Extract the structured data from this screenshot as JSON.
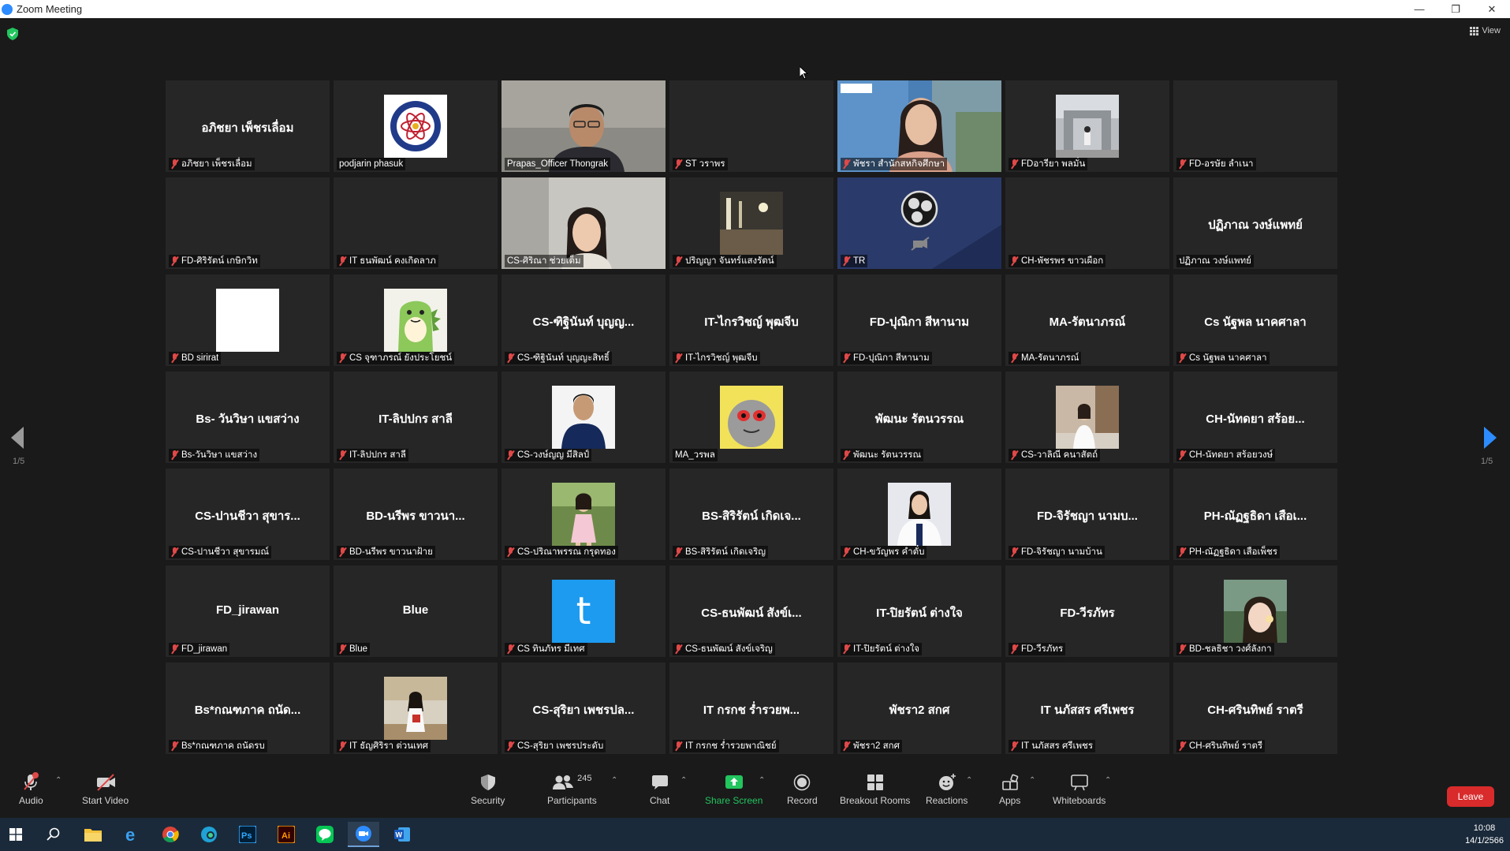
{
  "window": {
    "title": "Zoom Meeting"
  },
  "view_label": "View",
  "page_indicator": "1/5",
  "tiles": [
    {
      "center": "อภิชยา เพ็ชรเลื่อม",
      "label": "อภิชยา เพ็ชรเลื่อม",
      "muted": true,
      "kind": "name"
    },
    {
      "center": "",
      "label": "podjarin phasuk",
      "muted": false,
      "kind": "logo"
    },
    {
      "center": "",
      "label": "Prapas_Officer Thongrak",
      "muted": false,
      "kind": "video-man",
      "speaking": true
    },
    {
      "center": "",
      "label": "ST วราพร",
      "muted": true,
      "kind": "blank"
    },
    {
      "center": "",
      "label": "พัชรา สำนักสหกิจศึกษา",
      "muted": true,
      "kind": "video-woman"
    },
    {
      "center": "",
      "label": "FDอารียา พลมั่น",
      "muted": true,
      "kind": "photo-building"
    },
    {
      "center": "",
      "label": "FD-อรษัย ลำเนา",
      "muted": true,
      "kind": "blank"
    },
    {
      "center": "",
      "label": "FD-ศิริรัตน์ เกษิกวิท",
      "muted": true,
      "kind": "blank"
    },
    {
      "center": "",
      "label": "IT ธนพัฒน์ คงเกิดลาภ",
      "muted": true,
      "kind": "blank"
    },
    {
      "center": "",
      "label": "CS-ศิริณา ช่วยเต็ม",
      "muted": false,
      "kind": "video-girl"
    },
    {
      "center": "",
      "label": "ปริญญา จันทร์แสงรัตน์",
      "muted": true,
      "kind": "photo-dark"
    },
    {
      "center": "",
      "label": "TR",
      "muted": true,
      "kind": "obs"
    },
    {
      "center": "",
      "label": "CH-พัชรพร ขาวเผือก",
      "muted": true,
      "kind": "blank"
    },
    {
      "center": "ปฏิภาณ วงษ์แพทย์",
      "label": "ปฏิภาณ วงษ์แพทย์",
      "muted": false,
      "kind": "name"
    },
    {
      "center": "",
      "label": "BD sirirat",
      "muted": true,
      "kind": "white"
    },
    {
      "center": "",
      "label": "CS จุฑาภรณ์ ยังประโยชน์",
      "muted": true,
      "kind": "dino"
    },
    {
      "center": "CS-ฑิฐินันท์ บุญญ...",
      "label": "CS-ฑิฐินันท์ บุญญะสิทธิ์",
      "muted": true,
      "kind": "name"
    },
    {
      "center": "IT-ไกรวิชญ์ พุฒจีบ",
      "label": "IT-ไกรวิชญ์ พุฒจีบ",
      "muted": true,
      "kind": "name"
    },
    {
      "center": "FD-ปุณิกา สีหานาม",
      "label": "FD-ปุณิกา สีหานาม",
      "muted": true,
      "kind": "name"
    },
    {
      "center": "MA-รัตนาภรณ์",
      "label": "MA-รัตนาภรณ์",
      "muted": true,
      "kind": "name"
    },
    {
      "center": "Cs นัฐพล นาคศาลา",
      "label": "Cs นัฐพล นาคศาลา",
      "muted": true,
      "kind": "name"
    },
    {
      "center": "Bs- วันวิษา แขสว่าง",
      "label": "Bs-วันวิษา แขสว่าง",
      "muted": true,
      "kind": "name"
    },
    {
      "center": "IT-ลิปปกร สาลี",
      "label": "IT-ลิปปกร สาลี",
      "muted": true,
      "kind": "name"
    },
    {
      "center": "",
      "label": "CS-วงษ์ญญ มีสิลป์",
      "muted": true,
      "kind": "photo-boy"
    },
    {
      "center": "",
      "label": "MA_วรพล",
      "muted": false,
      "kind": "photo-yellow"
    },
    {
      "center": "พัฒนะ รัตนวรรณ",
      "label": "พัฒนะ รัตนวรรณ",
      "muted": true,
      "kind": "name"
    },
    {
      "center": "",
      "label": "CS-วาลิณี คนาสัตถ์",
      "muted": true,
      "kind": "photo-girl-stair"
    },
    {
      "center": "CH-นัทดยา สร้อย...",
      "label": "CH-นัทดยา สร้อยวงษ์",
      "muted": true,
      "kind": "name"
    },
    {
      "center": "CS-ปานชีวา สุขาร...",
      "label": "CS-ปานชีวา สุขารมณ์",
      "muted": true,
      "kind": "name"
    },
    {
      "center": "BD-นรีพร ขาวนา...",
      "label": "BD-นรีพร ขาวนาฝ้าย",
      "muted": true,
      "kind": "name"
    },
    {
      "center": "",
      "label": "CS-ปริณาพรรณ กรุดทอง",
      "muted": true,
      "kind": "photo-child"
    },
    {
      "center": "BS-สิริรัตน์ เกิดเจ...",
      "label": "BS-สิริรัตน์ เกิดเจริญ",
      "muted": true,
      "kind": "name"
    },
    {
      "center": "",
      "label": "CH-ขวัญพร คำตั๋บ",
      "muted": true,
      "kind": "photo-uniform"
    },
    {
      "center": "FD-จิรัชญา นามบ...",
      "label": "FD-จิรัชญา นามบ้าน",
      "muted": true,
      "kind": "name"
    },
    {
      "center": "PH-ณัฏฐธิดา เสือเ...",
      "label": "PH-ณัฏฐธิดา เสือเพ็ชร",
      "muted": true,
      "kind": "name"
    },
    {
      "center": "FD_jirawan",
      "label": "FD_jirawan",
      "muted": true,
      "kind": "name"
    },
    {
      "center": "Blue",
      "label": "Blue",
      "muted": true,
      "kind": "name"
    },
    {
      "center": "",
      "label": "CS ทินภัทร มีเทศ",
      "muted": true,
      "kind": "twitter-t",
      "letter": "t"
    },
    {
      "center": "CS-ธนพัฒน์ สังข์เ...",
      "label": "CS-ธนพัฒน์ สังข์เจริญ",
      "muted": true,
      "kind": "name"
    },
    {
      "center": "IT-ปิยรัตน์ ต่างใจ",
      "label": "IT-ปิยรัตน์ ต่างใจ",
      "muted": true,
      "kind": "name"
    },
    {
      "center": "FD-วีรภัทร",
      "label": "FD-วีรภัทร",
      "muted": true,
      "kind": "name"
    },
    {
      "center": "",
      "label": "BD-ชลธิชา วงศ์ลังกา",
      "muted": true,
      "kind": "photo-selfie"
    },
    {
      "center": "Bs*กณฑภาค ถนัด...",
      "label": "Bs*กณฑภาค ถนัดรบ",
      "muted": true,
      "kind": "name"
    },
    {
      "center": "",
      "label": "IT ธัญศิริรา ต่วนเทศ",
      "muted": true,
      "kind": "photo-outdoor"
    },
    {
      "center": "CS-สุริยา เพชรปล...",
      "label": "CS-สุริยา เพชรประดับ",
      "muted": true,
      "kind": "name"
    },
    {
      "center": "IT กรกช ร่ำรวยพ...",
      "label": "IT กรกช ร่ำรวยพาณิชย์",
      "muted": true,
      "kind": "name"
    },
    {
      "center": "พัชรา2 สกศ",
      "label": "พัชรา2 สกศ",
      "muted": true,
      "kind": "name"
    },
    {
      "center": "IT นภัสสร ศรีเพชร",
      "label": "IT นภัสสร ศรีเพชร",
      "muted": true,
      "kind": "name"
    },
    {
      "center": "CH-ศรินทิพย์ ราตรี",
      "label": "CH-ศรินทิพย์ ราตรี",
      "muted": true,
      "kind": "name"
    }
  ],
  "toolbar": {
    "audio": "Audio",
    "start_video": "Start Video",
    "security": "Security",
    "participants": "Participants",
    "participants_count": "245",
    "chat": "Chat",
    "share_screen": "Share Screen",
    "record": "Record",
    "breakout_rooms": "Breakout Rooms",
    "reactions": "Reactions",
    "apps": "Apps",
    "whiteboards": "Whiteboards",
    "leave": "Leave"
  },
  "taskbar": {
    "time": "10:08",
    "date": "14/1/2566"
  },
  "colors": {
    "share_green": "#22c55e",
    "leave_red": "#d92b2b",
    "speaking_border": "#b8e36b",
    "nav_blue": "#2d8cff"
  }
}
